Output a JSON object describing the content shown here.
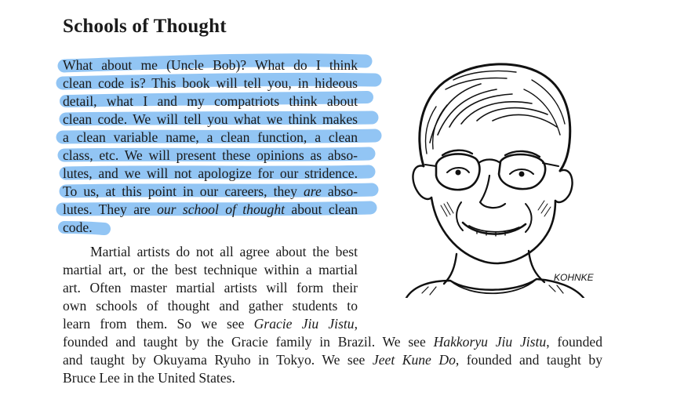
{
  "section": {
    "heading": "Schools of Thought"
  },
  "paragraph1": {
    "l1": "What about me (Uncle Bob)? What do I think",
    "l2": "clean code is? This book will tell you, in hideous",
    "l3": "detail, what I and my compatriots think about",
    "l4": "clean code. We will tell you what we think makes",
    "l5": "a clean variable name, a clean function, a clean",
    "l6": "class, etc. We will present these opinions as abso-",
    "l7": "lutes, and we will not apologize for our stridence.",
    "l8a": "To us, at this point in our careers, they ",
    "l8b": "are",
    "l8c": " abso-",
    "l9a": "lutes. They are ",
    "l9b": "our school of thought",
    "l9c": " about clean",
    "l10": "code."
  },
  "paragraph2": {
    "l1": "Martial artists do not all agree about the best",
    "l2": "martial art, or the best technique within a martial",
    "l3": "art. Often master martial artists will form their",
    "l4": "own schools of thought and gather students to",
    "l5a": "learn from them. So we see ",
    "l5b": "Gracie Jiu Jistu",
    "l5c": ",",
    "l6a": "founded and taught by the Gracie family in Brazil. We see ",
    "l6b": "Hakkoryu Jiu Jistu",
    "l6c": ", founded",
    "l7a": "and taught by Okuyama Ryuho in Tokyo. We see ",
    "l7b": "Jeet Kune Do",
    "l7c": ", founded and taught by",
    "l8": "Bruce Lee in the United States."
  },
  "illustration": {
    "signature": "KOHNKE"
  },
  "colors": {
    "highlight": "#8cc2f3",
    "text": "#1a1a1a"
  }
}
